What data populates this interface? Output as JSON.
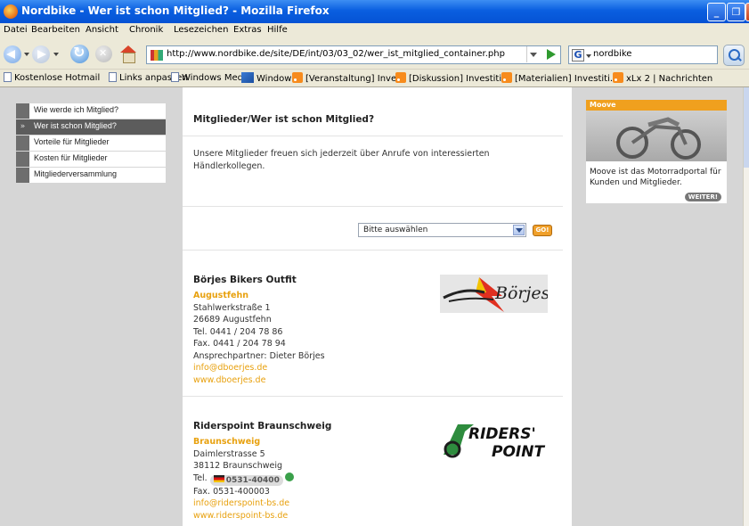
{
  "window": {
    "title": "Nordbike - Wer ist schon Mitglied? - Mozilla Firefox"
  },
  "menu": {
    "items": [
      "Datei",
      "Bearbeiten",
      "Ansicht",
      "Chronik",
      "Lesezeichen",
      "Extras",
      "Hilfe"
    ]
  },
  "toolbar": {
    "url": "http://www.nordbike.de/site/DE/int/03/03_02/wer_ist_mitglied_container.php",
    "search_value": "nordbike",
    "search_engine_label": "G"
  },
  "bookmarks": {
    "items": [
      "Kostenlose Hotmail",
      "Links anpassen",
      "Windows Media",
      "Windows",
      "[Veranstaltung] Inve...",
      "[Diskussion] Investiti...",
      "[Materialien] Investiti...",
      "xLx 2 | Nachrichten"
    ]
  },
  "sidebar": {
    "active_marker": "»",
    "items": [
      "Wie werde ich Mitglied?",
      "Wer ist schon Mitglied?",
      "Vorteile für Mitglieder",
      "Kosten für Mitglieder",
      "Mitgliederversammlung"
    ],
    "active_index": 1
  },
  "main": {
    "heading": "Mitglieder/Wer ist schon Mitglied?",
    "intro": "Unsere Mitglieder freuen sich jederzeit über Anrufe von interessierten Händlerkollegen.",
    "select_value": "Bitte auswählen",
    "go_label": "GO!"
  },
  "dealers": [
    {
      "name": "Börjes Bikers Outfit",
      "city": "Augustfehn",
      "street": "Stahlwerkstraße 1",
      "zip_city": "26689 Augustfehn",
      "tel": "Tel. 0441 / 204 78 86",
      "fax": "Fax. 0441 / 204 78 94",
      "contact": "Ansprechpartner: Dieter Börjes",
      "email": "info@dboerjes.de",
      "web": "www.dboerjes.de",
      "logo_text": "Börjes"
    },
    {
      "name": "Riderspoint Braunschweig",
      "city": "Braunschweig",
      "street": "Daimlerstrasse 5",
      "zip_city": "38112 Braunschweig",
      "tel_prefix": "Tel.",
      "tel_number": "0531-40400",
      "fax": "Fax. 0531-400003",
      "email": "info@riderspoint-bs.de",
      "web": "www.riderspoint-bs.de",
      "logo_line1": "RIDERS'",
      "logo_line2": "POINT"
    }
  ],
  "teaser": {
    "header": "Moove",
    "text": "Moove ist das Motorradportal für Kunden und Mitglieder.",
    "button": "WEITER!"
  },
  "colors": {
    "accent_orange": "#e8a10f",
    "nav_active": "#5c5c5c",
    "titlebar_blue": "#0a5fe0"
  }
}
